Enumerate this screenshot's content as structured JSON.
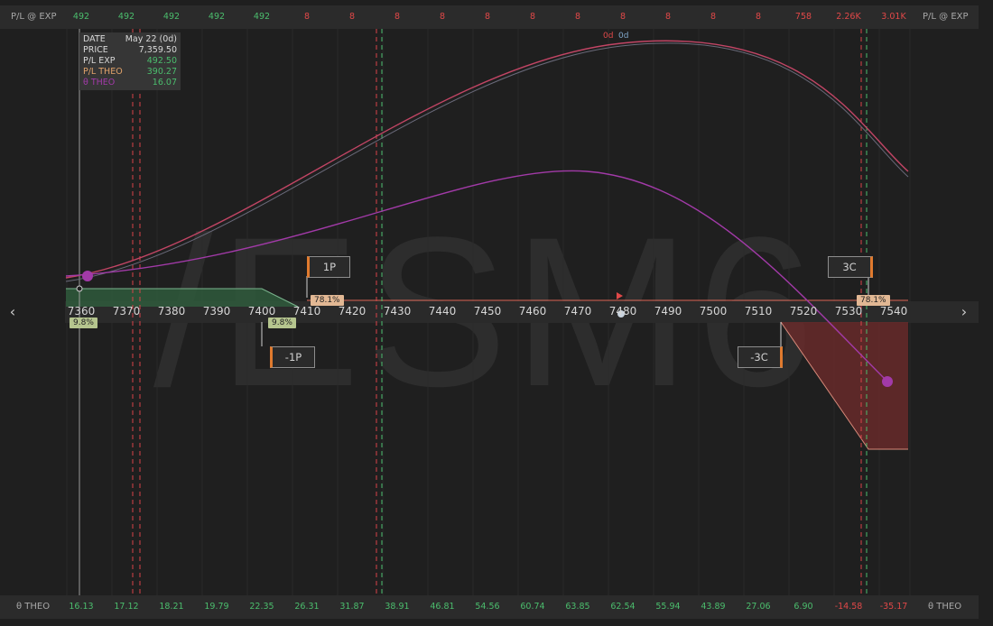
{
  "watermark": "/ESM6",
  "top_row": {
    "label_left": "P/L @ EXP",
    "label_right": "P/L @ EXP",
    "values": [
      {
        "text": "492",
        "tone": "pos"
      },
      {
        "text": "492",
        "tone": "pos"
      },
      {
        "text": "492",
        "tone": "pos"
      },
      {
        "text": "492",
        "tone": "pos"
      },
      {
        "text": "492",
        "tone": "pos"
      },
      {
        "text": "8",
        "tone": "neg"
      },
      {
        "text": "8",
        "tone": "neg"
      },
      {
        "text": "8",
        "tone": "neg"
      },
      {
        "text": "8",
        "tone": "neg"
      },
      {
        "text": "8",
        "tone": "neg"
      },
      {
        "text": "8",
        "tone": "neg"
      },
      {
        "text": "8",
        "tone": "neg"
      },
      {
        "text": "8",
        "tone": "neg"
      },
      {
        "text": "8",
        "tone": "neg"
      },
      {
        "text": "8",
        "tone": "neg"
      },
      {
        "text": "8",
        "tone": "neg"
      },
      {
        "text": "758",
        "tone": "neg"
      },
      {
        "text": "2.26K",
        "tone": "neg"
      },
      {
        "text": "3.01K",
        "tone": "neg"
      }
    ]
  },
  "bottom_row": {
    "label_left": "θ THEO",
    "label_right": "θ THEO",
    "values": [
      {
        "text": "16.13",
        "tone": "pos"
      },
      {
        "text": "17.12",
        "tone": "pos"
      },
      {
        "text": "18.21",
        "tone": "pos"
      },
      {
        "text": "19.79",
        "tone": "pos"
      },
      {
        "text": "22.35",
        "tone": "pos"
      },
      {
        "text": "26.31",
        "tone": "pos"
      },
      {
        "text": "31.87",
        "tone": "pos"
      },
      {
        "text": "38.91",
        "tone": "pos"
      },
      {
        "text": "46.81",
        "tone": "pos"
      },
      {
        "text": "54.56",
        "tone": "pos"
      },
      {
        "text": "60.74",
        "tone": "pos"
      },
      {
        "text": "63.85",
        "tone": "pos"
      },
      {
        "text": "62.54",
        "tone": "pos"
      },
      {
        "text": "55.94",
        "tone": "pos"
      },
      {
        "text": "43.89",
        "tone": "pos"
      },
      {
        "text": "27.06",
        "tone": "pos"
      },
      {
        "text": "6.90",
        "tone": "pos"
      },
      {
        "text": "-14.58",
        "tone": "neg"
      },
      {
        "text": "-35.17",
        "tone": "neg"
      }
    ]
  },
  "tooltip": {
    "date_label": "DATE",
    "date_value": "May 22 (0d)",
    "price_label": "PRICE",
    "price_value": "7,359.50",
    "plexp_label": "P/L EXP",
    "plexp_value": "492.50",
    "pltheo_label": "P/L THEO",
    "pltheo_value": "390.27",
    "theta_label": "θ THEO",
    "theta_value": "16.07"
  },
  "price_axis": {
    "ticks": [
      "7360",
      "7370",
      "7380",
      "7390",
      "7400",
      "7410",
      "7420",
      "7430",
      "7440",
      "7450",
      "7460",
      "7470",
      "7480",
      "7490",
      "7500",
      "7510",
      "7520",
      "7530",
      "7540"
    ],
    "range": [
      7357,
      7546
    ]
  },
  "dte_labels": [
    "0d",
    "0d"
  ],
  "legs": [
    {
      "label": "1P",
      "strike": 7410,
      "side": "above"
    },
    {
      "label": "-1P",
      "strike": 7405,
      "side": "below"
    },
    {
      "label": "3C",
      "strike": 7535,
      "side": "above"
    },
    {
      "label": "-3C",
      "strike": 7515,
      "side": "below"
    }
  ],
  "probabilities": [
    {
      "text": "9.8%",
      "tone": "green",
      "strike": 7361
    },
    {
      "text": "9.8%",
      "tone": "green",
      "strike": 7405
    },
    {
      "text": "78.1%",
      "tone": "orange",
      "strike": 7410
    },
    {
      "text": "78.1%",
      "tone": "orange",
      "strike": 7535
    }
  ],
  "colors": {
    "profit": "#4bbd6d",
    "loss": "#e04848",
    "pl_theo": "#d2426a",
    "theta": "#a23aa8",
    "background": "#1f1f1f"
  },
  "nav": {
    "left_icon": "chevron-left-icon",
    "right_icon": "chevron-right-icon"
  }
}
